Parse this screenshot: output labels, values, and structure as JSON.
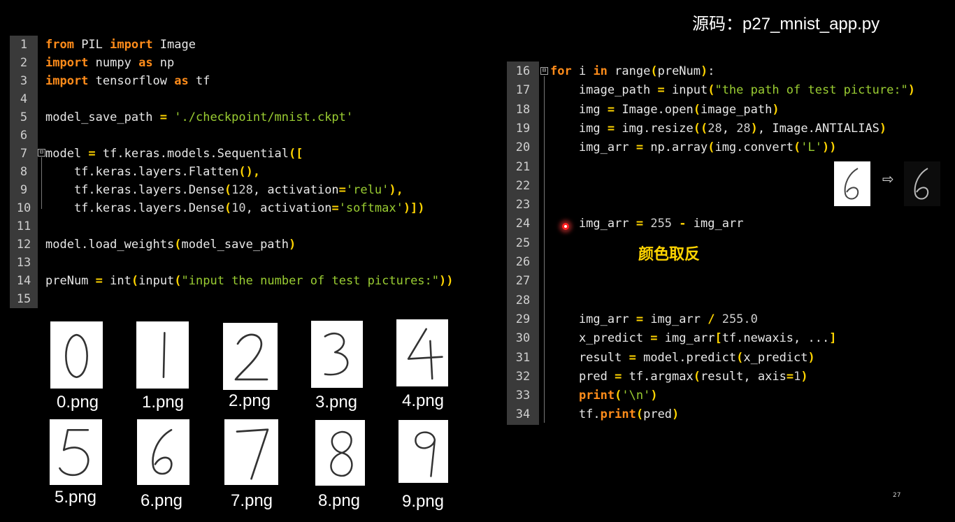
{
  "title": "源码：p27_mnist_app.py",
  "left_code": [
    {
      "n": "1",
      "parts": [
        [
          "kw",
          "from"
        ],
        [
          "t",
          " PIL "
        ],
        [
          "kw",
          "import"
        ],
        [
          "t",
          " Image"
        ]
      ]
    },
    {
      "n": "2",
      "parts": [
        [
          "kw",
          "import"
        ],
        [
          "t",
          " numpy "
        ],
        [
          "kw",
          "as"
        ],
        [
          "t",
          " np"
        ]
      ]
    },
    {
      "n": "3",
      "parts": [
        [
          "kw",
          "import"
        ],
        [
          "t",
          " tensorflow "
        ],
        [
          "kw",
          "as"
        ],
        [
          "t",
          " tf"
        ]
      ]
    },
    {
      "n": "4",
      "parts": []
    },
    {
      "n": "5",
      "parts": [
        [
          "t",
          "model_save_path "
        ],
        [
          "op",
          "="
        ],
        [
          "t",
          " "
        ],
        [
          "str",
          "'./checkpoint/mnist.ckpt'"
        ]
      ]
    },
    {
      "n": "6",
      "parts": []
    },
    {
      "n": "7",
      "parts": [
        [
          "t",
          "model "
        ],
        [
          "op",
          "="
        ],
        [
          "t",
          " tf.keras.models.Sequential"
        ],
        [
          "op",
          "(["
        ]
      ]
    },
    {
      "n": "8",
      "parts": [
        [
          "t",
          "    tf.keras.layers.Flatten"
        ],
        [
          "op",
          "(),"
        ]
      ]
    },
    {
      "n": "9",
      "parts": [
        [
          "t",
          "    tf.keras.layers.Dense"
        ],
        [
          "op",
          "("
        ],
        [
          "num",
          "128"
        ],
        [
          "t",
          ", activation"
        ],
        [
          "op",
          "="
        ],
        [
          "str",
          "'relu'"
        ],
        [
          "op",
          "),"
        ]
      ]
    },
    {
      "n": "10",
      "parts": [
        [
          "t",
          "    tf.keras.layers.Dense"
        ],
        [
          "op",
          "("
        ],
        [
          "num",
          "10"
        ],
        [
          "t",
          ", activation"
        ],
        [
          "op",
          "="
        ],
        [
          "str",
          "'softmax'"
        ],
        [
          "op",
          ")])"
        ]
      ]
    },
    {
      "n": "11",
      "parts": []
    },
    {
      "n": "12",
      "parts": [
        [
          "t",
          "model.load_weights"
        ],
        [
          "op",
          "("
        ],
        [
          "t",
          "model_save_path"
        ],
        [
          "op",
          ")"
        ]
      ]
    },
    {
      "n": "13",
      "parts": []
    },
    {
      "n": "14",
      "parts": [
        [
          "t",
          "preNum "
        ],
        [
          "op",
          "="
        ],
        [
          "t",
          " int"
        ],
        [
          "op",
          "("
        ],
        [
          "t",
          "input"
        ],
        [
          "op",
          "("
        ],
        [
          "str",
          "\"input the number of test pictures:\""
        ],
        [
          "op",
          "))"
        ]
      ]
    },
    {
      "n": "15",
      "parts": []
    }
  ],
  "right_code": [
    {
      "n": "16",
      "parts": [
        [
          "kw",
          "for"
        ],
        [
          "t",
          " i "
        ],
        [
          "kw",
          "in"
        ],
        [
          "t",
          " range"
        ],
        [
          "op",
          "("
        ],
        [
          "t",
          "preNum"
        ],
        [
          "op",
          ")"
        ],
        [
          "t",
          ":"
        ]
      ]
    },
    {
      "n": "17",
      "parts": [
        [
          "t",
          "    image_path "
        ],
        [
          "op",
          "="
        ],
        [
          "t",
          " input"
        ],
        [
          "op",
          "("
        ],
        [
          "str",
          "\"the path of test picture:\""
        ],
        [
          "op",
          ")"
        ]
      ]
    },
    {
      "n": "18",
      "parts": [
        [
          "t",
          "    img "
        ],
        [
          "op",
          "="
        ],
        [
          "t",
          " Image.open"
        ],
        [
          "op",
          "("
        ],
        [
          "t",
          "image_path"
        ],
        [
          "op",
          ")"
        ]
      ]
    },
    {
      "n": "19",
      "parts": [
        [
          "t",
          "    img "
        ],
        [
          "op",
          "="
        ],
        [
          "t",
          " img.resize"
        ],
        [
          "op",
          "(("
        ],
        [
          "num",
          "28"
        ],
        [
          "t",
          ", "
        ],
        [
          "num",
          "28"
        ],
        [
          "op",
          ")"
        ],
        [
          "t",
          ", Image.ANTIALIAS"
        ],
        [
          "op",
          ")"
        ]
      ]
    },
    {
      "n": "20",
      "parts": [
        [
          "t",
          "    img_arr "
        ],
        [
          "op",
          "="
        ],
        [
          "t",
          " np.array"
        ],
        [
          "op",
          "("
        ],
        [
          "t",
          "img.convert"
        ],
        [
          "op",
          "("
        ],
        [
          "str",
          "'L'"
        ],
        [
          "op",
          "))"
        ]
      ]
    },
    {
      "n": "21",
      "parts": []
    },
    {
      "n": "22",
      "parts": []
    },
    {
      "n": "23",
      "parts": []
    },
    {
      "n": "24",
      "parts": [
        [
          "t",
          "    img_arr "
        ],
        [
          "op",
          "="
        ],
        [
          "t",
          " "
        ],
        [
          "num",
          "255"
        ],
        [
          "t",
          " "
        ],
        [
          "op",
          "-"
        ],
        [
          "t",
          " img_arr"
        ]
      ]
    },
    {
      "n": "25",
      "parts": []
    },
    {
      "n": "26",
      "parts": []
    },
    {
      "n": "27",
      "parts": []
    },
    {
      "n": "28",
      "parts": []
    },
    {
      "n": "29",
      "parts": [
        [
          "t",
          "    img_arr "
        ],
        [
          "op",
          "="
        ],
        [
          "t",
          " img_arr "
        ],
        [
          "op",
          "/"
        ],
        [
          "t",
          " "
        ],
        [
          "num",
          "255.0"
        ]
      ]
    },
    {
      "n": "30",
      "parts": [
        [
          "t",
          "    x_predict "
        ],
        [
          "op",
          "="
        ],
        [
          "t",
          " img_arr"
        ],
        [
          "op",
          "["
        ],
        [
          "t",
          "tf.newaxis, ..."
        ],
        [
          "op",
          "]"
        ]
      ]
    },
    {
      "n": "31",
      "parts": [
        [
          "t",
          "    result "
        ],
        [
          "op",
          "="
        ],
        [
          "t",
          " model.predict"
        ],
        [
          "op",
          "("
        ],
        [
          "t",
          "x_predict"
        ],
        [
          "op",
          ")"
        ]
      ]
    },
    {
      "n": "32",
      "parts": [
        [
          "t",
          "    pred "
        ],
        [
          "op",
          "="
        ],
        [
          "t",
          " tf.argmax"
        ],
        [
          "op",
          "("
        ],
        [
          "t",
          "result, axis"
        ],
        [
          "op",
          "="
        ],
        [
          "num",
          "1"
        ],
        [
          "op",
          ")"
        ]
      ]
    },
    {
      "n": "33",
      "parts": [
        [
          "t",
          "    "
        ],
        [
          "kw",
          "print"
        ],
        [
          "op",
          "("
        ],
        [
          "str",
          "'\\n'"
        ],
        [
          "op",
          ")"
        ]
      ]
    },
    {
      "n": "34",
      "parts": [
        [
          "t",
          "    tf."
        ],
        [
          "kw",
          "print"
        ],
        [
          "op",
          "("
        ],
        [
          "t",
          "pred"
        ],
        [
          "op",
          ")"
        ]
      ]
    }
  ],
  "annotation": "颜色取反",
  "digits": [
    {
      "digit": "0",
      "label": "0.png"
    },
    {
      "digit": "1",
      "label": "1.png"
    },
    {
      "digit": "2",
      "label": "2.png"
    },
    {
      "digit": "3",
      "label": "3.png"
    },
    {
      "digit": "4",
      "label": "4.png"
    },
    {
      "digit": "5",
      "label": "5.png"
    },
    {
      "digit": "6",
      "label": "6.png"
    },
    {
      "digit": "7",
      "label": "7.png"
    },
    {
      "digit": "8",
      "label": "8.png"
    },
    {
      "digit": "9",
      "label": "9.png"
    }
  ],
  "invert_demo": {
    "digit": "6"
  },
  "page_number": "27"
}
